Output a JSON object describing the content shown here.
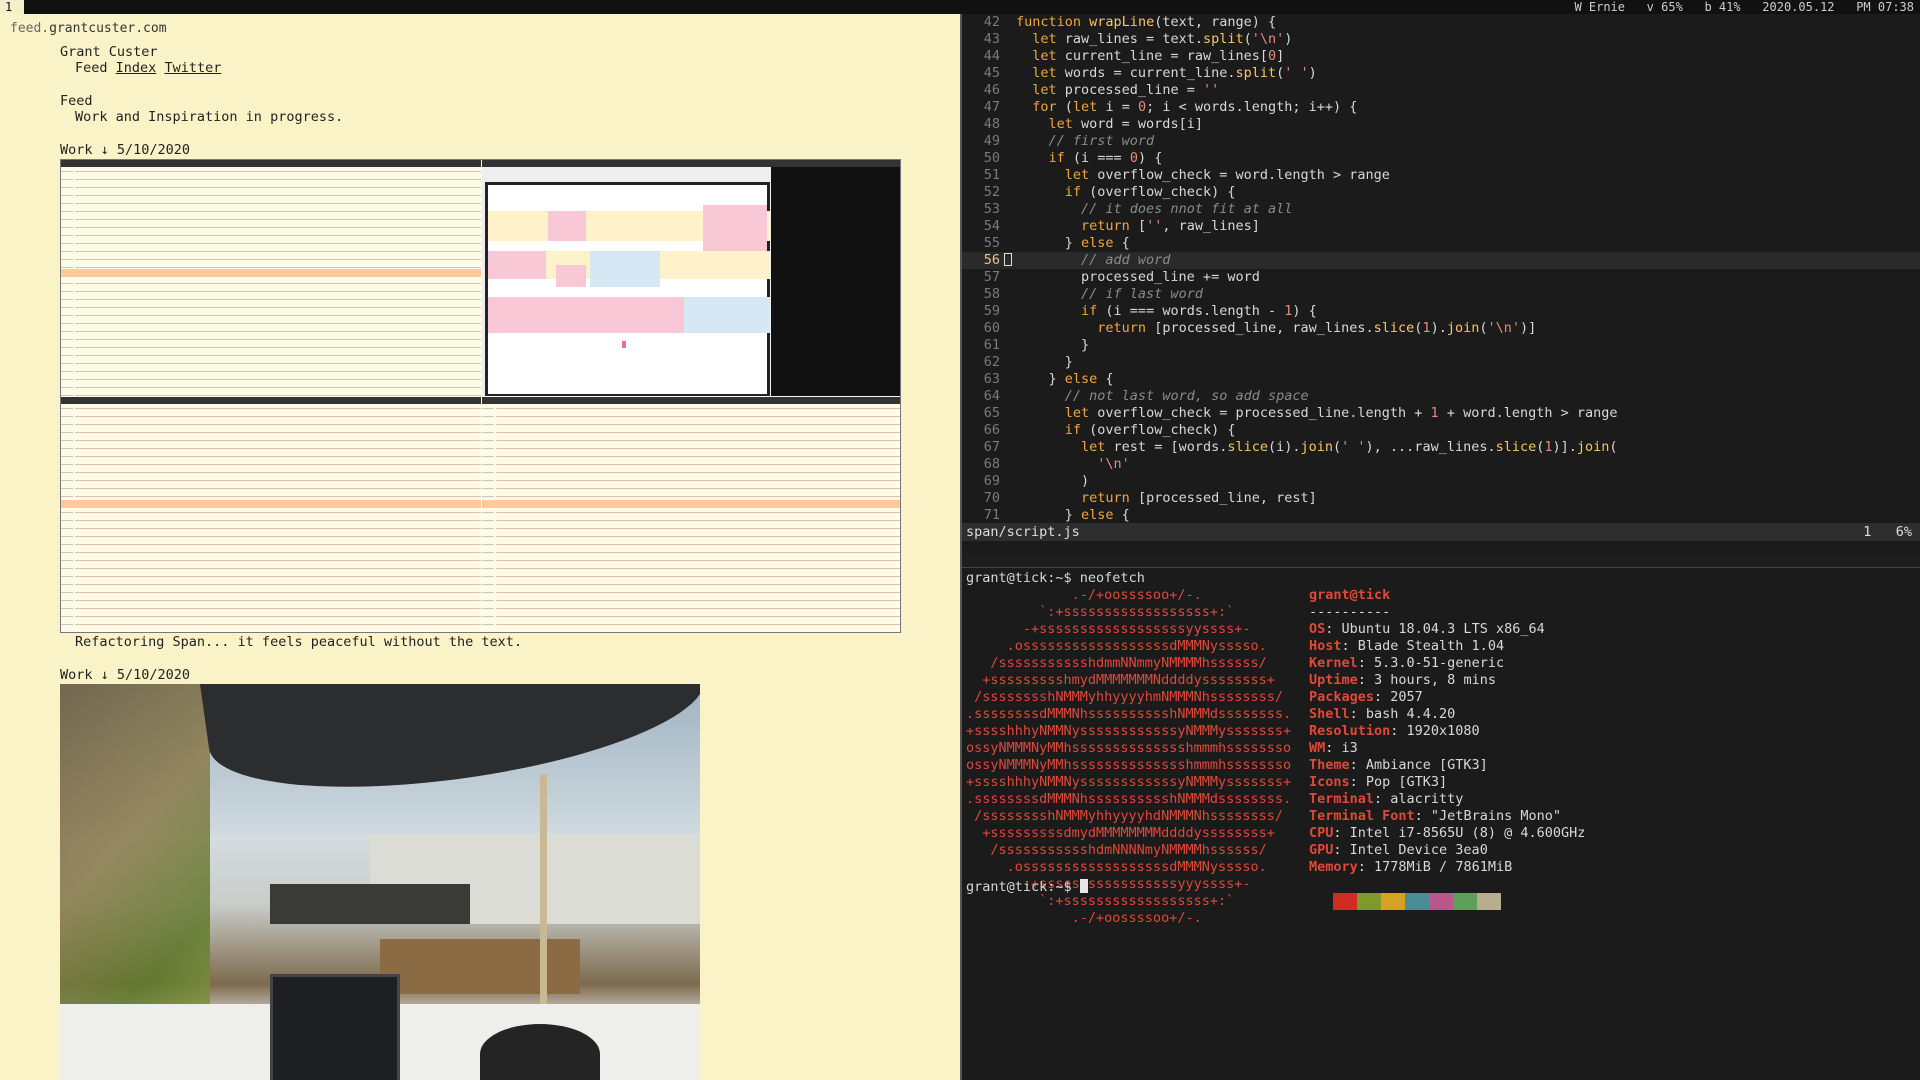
{
  "bar": {
    "workspace": "1",
    "status": "W Ernie   v 65%   b 41%   2020.05.12   PM 07:38"
  },
  "browser": {
    "url_prefix": "feed.",
    "url_host": "grantcuster.com",
    "author": "Grant Custer",
    "nav_feed": "Feed",
    "nav_index": "Index",
    "nav_twitter": "Twitter",
    "heading": "Feed",
    "subheading": "Work and Inspiration in progress.",
    "posts": [
      {
        "header": "Work ↓ 5/10/2020",
        "caption": "Refactoring Span... it feels peaceful without the text."
      },
      {
        "header": "Work ↓ 5/10/2020",
        "caption": ""
      }
    ]
  },
  "editor": {
    "lines": [
      {
        "n": "42",
        "t": "function wrapLine(text, range) {"
      },
      {
        "n": "43",
        "t": "  let raw_lines = text.split('\\n')"
      },
      {
        "n": "44",
        "t": "  let current_line = raw_lines[0]"
      },
      {
        "n": "45",
        "t": "  let words = current_line.split(' ')"
      },
      {
        "n": "46",
        "t": "  let processed_line = ''"
      },
      {
        "n": "47",
        "t": "  for (let i = 0; i < words.length; i++) {"
      },
      {
        "n": "48",
        "t": "    let word = words[i]"
      },
      {
        "n": "49",
        "t": "    // first word"
      },
      {
        "n": "50",
        "t": "    if (i === 0) {"
      },
      {
        "n": "51",
        "t": "      let overflow_check = word.length > range"
      },
      {
        "n": "52",
        "t": "      if (overflow_check) {"
      },
      {
        "n": "53",
        "t": "        // it does nnot fit at all"
      },
      {
        "n": "54",
        "t": "        return ['', raw_lines]"
      },
      {
        "n": "55",
        "t": "      } else {"
      },
      {
        "n": "56",
        "t": "        // add word"
      },
      {
        "n": "57",
        "t": "        processed_line += word"
      },
      {
        "n": "58",
        "t": "        // if last word"
      },
      {
        "n": "59",
        "t": "        if (i === words.length - 1) {"
      },
      {
        "n": "60",
        "t": "          return [processed_line, raw_lines.slice(1).join('\\n')]"
      },
      {
        "n": "61",
        "t": "        }"
      },
      {
        "n": "62",
        "t": "      }"
      },
      {
        "n": "63",
        "t": "    } else {"
      },
      {
        "n": "64",
        "t": "      // not last word, so add space"
      },
      {
        "n": "65",
        "t": "      let overflow_check = processed_line.length + 1 + word.length > range"
      },
      {
        "n": "66",
        "t": "      if (overflow_check) {"
      },
      {
        "n": "67",
        "t": "        let rest = [words.slice(i).join(' '), ...raw_lines.slice(1)].join("
      },
      {
        "n": "68",
        "t": "          '\\n'"
      },
      {
        "n": "69",
        "t": "        )"
      },
      {
        "n": "70",
        "t": "        return [processed_line, rest]"
      },
      {
        "n": "71",
        "t": "      } else {"
      }
    ],
    "current_line": "56",
    "filename": "span/script.js",
    "position": "1   6%"
  },
  "terminal": {
    "prompt1": "grant@tick:~$ ",
    "command": "neofetch",
    "logo": [
      "             .-/+oossssoo+/-.",
      "         `:+ssssssssssssssssss+:`",
      "       -+ssssssssssssssssssyyssss+-",
      "     .ossssssssssssssssssdMMMNysssso.",
      "   /ssssssssssshdmmNNmmyNMMMMhssssss/",
      "  +ssssssssshmydMMMMMMMNddddyssssssss+",
      " /sssssssshNMMMyhhyyyyhmNMMMNhssssssss/",
      ".ssssssssdMMMNhsssssssssshNMMMdssssssss.",
      "+sssshhhyNMMNyssssssssssssyNMMMysssssss+",
      "ossyNMMMNyMMhsssssssssssssshmmmhssssssso",
      "ossyNMMMNyMMhsssssssssssssshmmmhssssssso",
      "+sssshhhyNMMNyssssssssssssyNMMMysssssss+",
      ".ssssssssdMMMNhsssssssssshNMMMdssssssss.",
      " /sssssssshNMMMyhhyyyyhdNMMMNhssssssss/",
      "  +sssssssssdmydMMMMMMMMddddyssssssss+",
      "   /ssssssssssshdmNNNNmyNMMMMhssssss/",
      "     .ossssssssssssssssssdMMMNysssso.",
      "       -+sssssssssssssssssyyyssss+-",
      "         `:+ssssssssssssssssss+:`",
      "             .-/+oossssoo+/-."
    ],
    "user_host": "grant@tick",
    "separator": "----------",
    "info": [
      {
        "k": "OS",
        "v": ": Ubuntu 18.04.3 LTS x86_64"
      },
      {
        "k": "Host",
        "v": ": Blade Stealth 1.04"
      },
      {
        "k": "Kernel",
        "v": ": 5.3.0-51-generic"
      },
      {
        "k": "Uptime",
        "v": ": 3 hours, 8 mins"
      },
      {
        "k": "Packages",
        "v": ": 2057"
      },
      {
        "k": "Shell",
        "v": ": bash 4.4.20"
      },
      {
        "k": "Resolution",
        "v": ": 1920x1080"
      },
      {
        "k": "WM",
        "v": ": i3"
      },
      {
        "k": "Theme",
        "v": ": Ambiance [GTK3]"
      },
      {
        "k": "Icons",
        "v": ": Pop [GTK3]"
      },
      {
        "k": "Terminal",
        "v": ": alacritty"
      },
      {
        "k": "Terminal Font",
        "v": ": \"JetBrains Mono\""
      },
      {
        "k": "CPU",
        "v": ": Intel i7-8565U (8) @ 4.600GHz"
      },
      {
        "k": "GPU",
        "v": ": Intel Device 3ea0"
      },
      {
        "k": "Memory",
        "v": ": 1778MiB / 7861MiB"
      }
    ],
    "palette": [
      "#d02c23",
      "#7e9a28",
      "#d4a324",
      "#4a8d96",
      "#b8588c",
      "#5f9e5b",
      "#b9ad91"
    ],
    "prompt2": "grant@tick:~$ "
  }
}
